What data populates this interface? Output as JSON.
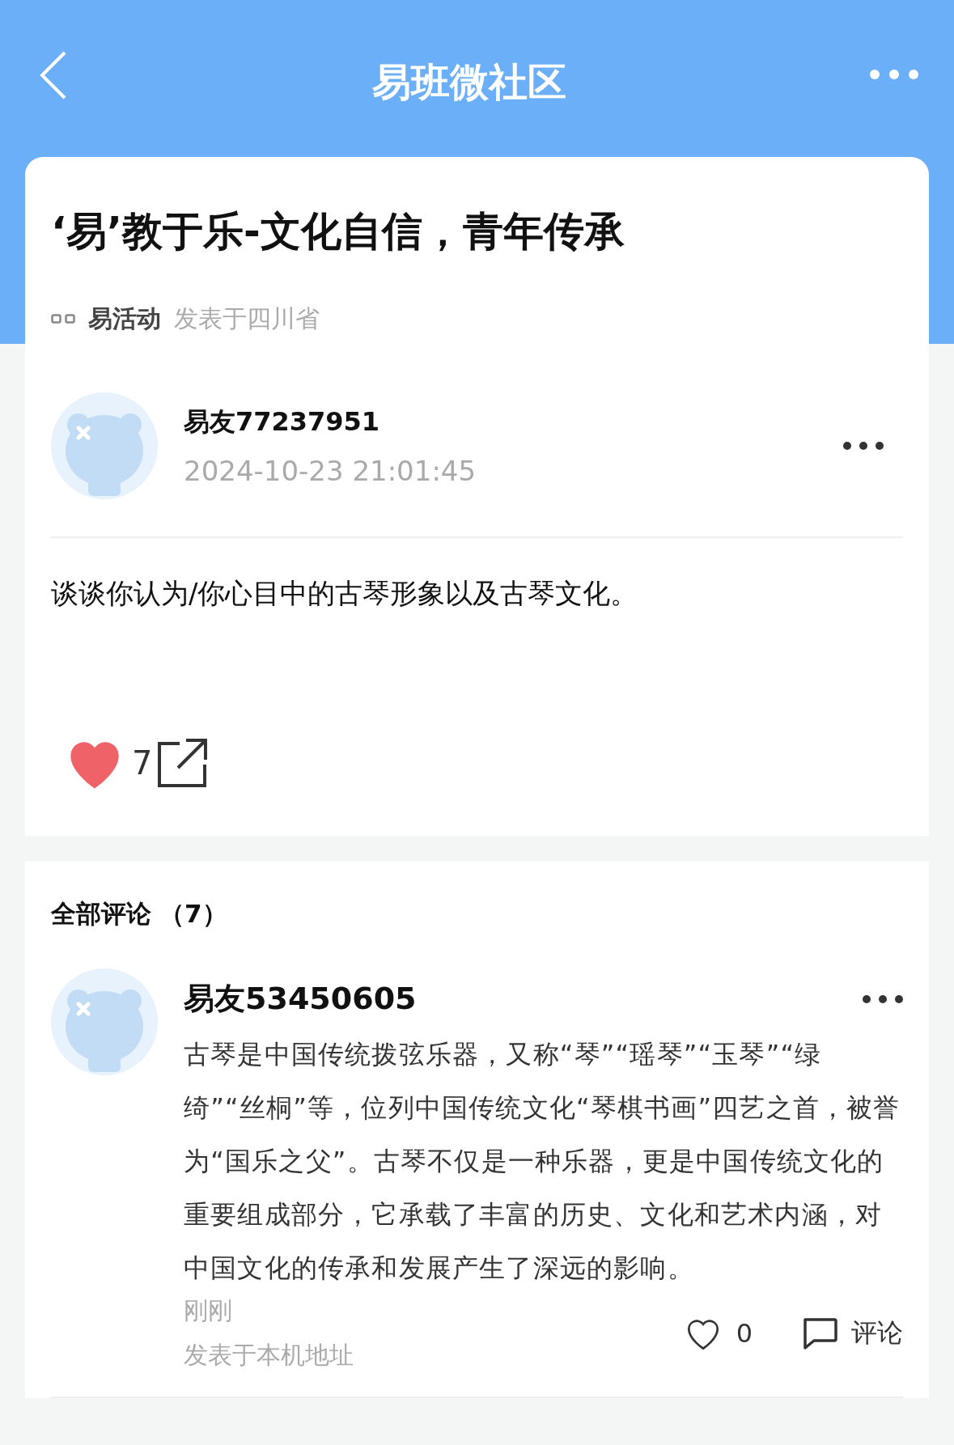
{
  "nav": {
    "title": "易班微社区"
  },
  "post": {
    "title": "‘易’教于乐-文化自信，青年传承",
    "topic": "易活动",
    "location": "发表于四川省",
    "author": "易友77237951",
    "time": "2024-10-23 21:01:45",
    "body": "谈谈你认为/你心目中的古琴形象以及古琴文化。",
    "likes": "7",
    "liked": true
  },
  "comments_header": {
    "label": "全部评论",
    "count": "（7）"
  },
  "comments": [
    {
      "author": "易友53450605",
      "text": "古琴是中国传统拨弦乐器，又称“琴”“瑶琴”“玉琴”“绿绮”“丝桐”等，位列中国传统文化“琴棋书画”四艺之首，被誉为“国乐之父”。古琴不仅是一种乐器，更是中国传统文化的重要组成部分，它承载了丰富的历史、文化和艺术内涵，对中国文化的传承和发展产生了深远的影响。",
      "time": "刚刚",
      "location": "发表于本机地址",
      "likes": "0",
      "liked": false,
      "reply_label": "评论"
    }
  ]
}
